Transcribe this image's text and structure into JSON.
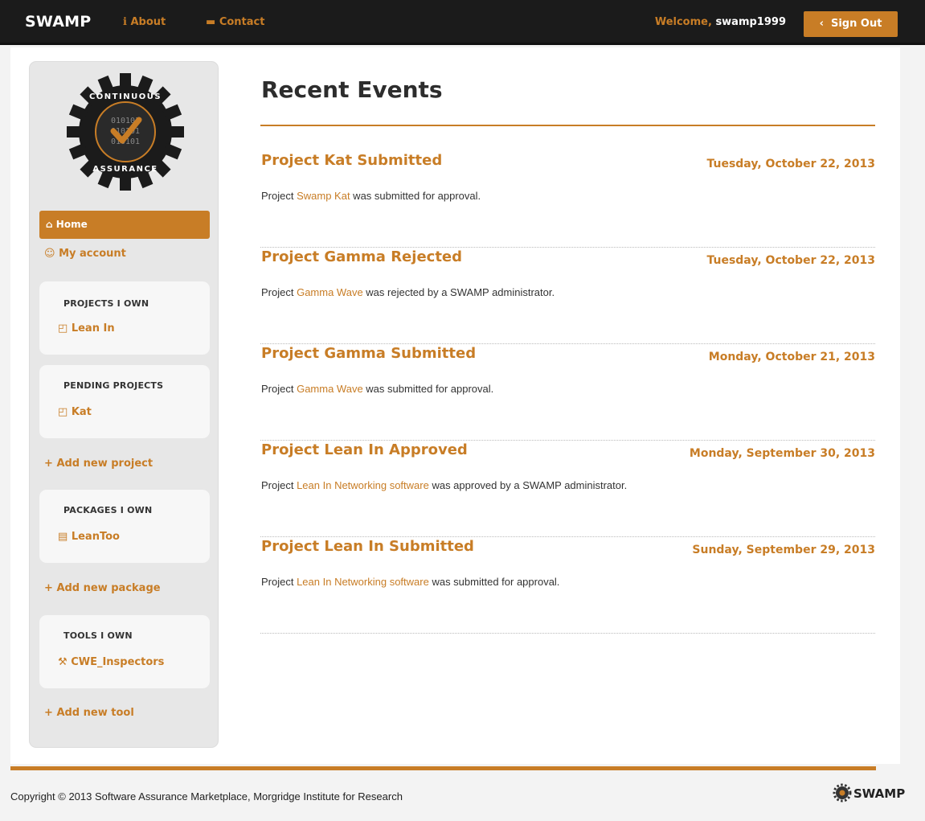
{
  "nav": {
    "brand": "SWAMP",
    "about": "About",
    "contact": "Contact",
    "welcome_label": "Welcome,",
    "username": "swamp1999",
    "sign_out": "Sign Out"
  },
  "sidebar": {
    "logo_text_top": "CONTINUOUS",
    "logo_text_bottom": "ASSURANCE",
    "logo_binary": [
      "010101",
      "010101",
      "010101"
    ],
    "home": "Home",
    "my_account": "My account",
    "projects_i_own": {
      "title": "PROJECTS I OWN",
      "items": [
        "Lean In"
      ]
    },
    "pending_projects": {
      "title": "PENDING PROJECTS",
      "items": [
        "Kat"
      ]
    },
    "add_project": "Add new project",
    "packages_i_own": {
      "title": "PACKAGES I OWN",
      "items": [
        "LeanToo"
      ]
    },
    "add_package": "Add new package",
    "tools_i_own": {
      "title": "TOOLS I OWN",
      "items": [
        "CWE_Inspectors"
      ]
    },
    "add_tool": "Add new tool"
  },
  "main": {
    "title": "Recent Events",
    "events": [
      {
        "title": "Project Kat Submitted",
        "date": "Tuesday, October 22, 2013",
        "pre": "Project ",
        "link": "Swamp Kat",
        "post": " was submitted for approval."
      },
      {
        "title": "Project Gamma Rejected",
        "date": "Tuesday, October 22, 2013",
        "pre": "Project ",
        "link": "Gamma Wave",
        "post": " was rejected by a SWAMP administrator."
      },
      {
        "title": "Project Gamma Submitted",
        "date": "Monday, October 21, 2013",
        "pre": "Project ",
        "link": "Gamma Wave",
        "post": " was submitted for approval."
      },
      {
        "title": "Project Lean In Approved",
        "date": "Monday, September 30, 2013",
        "pre": "Project ",
        "link": "Lean In Networking software",
        "post": " was approved by a SWAMP administrator."
      },
      {
        "title": "Project Lean In Submitted",
        "date": "Sunday, September 29, 2013",
        "pre": "Project ",
        "link": "Lean In Networking software",
        "post": " was submitted for approval."
      }
    ]
  },
  "footer": {
    "copyright": "Copyright © 2013 Software Assurance Marketplace, Morgridge Institute for Research",
    "logo_text": "SWAMP"
  },
  "colors": {
    "accent": "#c87d26",
    "nav_bg": "#1b1b1b",
    "sidebar_bg": "#e7e7e7"
  }
}
